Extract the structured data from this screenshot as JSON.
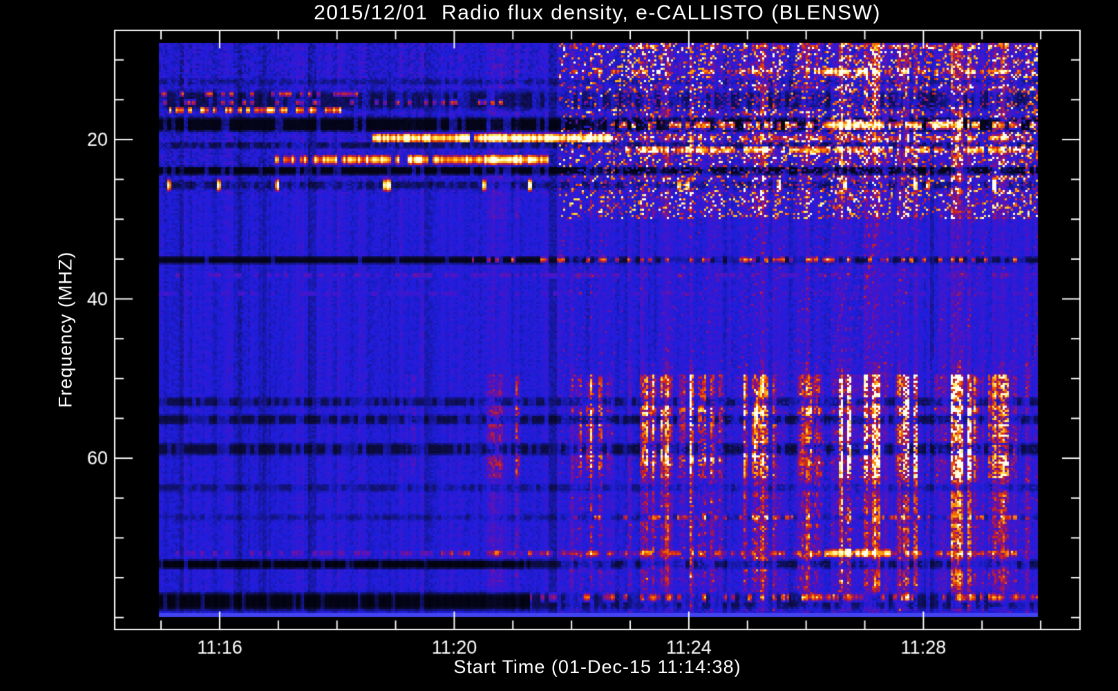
{
  "window": {
    "background": "#000000",
    "frame_color": "#ffffff",
    "text_color": "#ffffff"
  },
  "chart_data": {
    "type": "heatmap",
    "title": "2015/12/01  Radio flux density, e-CALLISTO (BLENSW)",
    "xlabel": "Start Time (01-Dec-15 11:14:38)",
    "ylabel": "Frequency (MHZ)",
    "legend": "none",
    "grid": false,
    "x_axis": {
      "unit": "time (HH:MM)",
      "major_ticks": [
        {
          "label": "11:16",
          "min": 16
        },
        {
          "label": "11:20",
          "min": 20
        },
        {
          "label": "11:24",
          "min": 24
        },
        {
          "label": "11:28",
          "min": 28
        }
      ],
      "minor_step_min": 1,
      "frame_range_min": [
        14.21,
        30.67
      ],
      "data_range_min": [
        14.96,
        29.95
      ]
    },
    "y_axis": {
      "unit": "MHz",
      "major_ticks": [
        20,
        40,
        60
      ],
      "minor_step": 5,
      "minor_range": [
        10,
        80
      ],
      "frame_range_mhz": [
        6.3,
        81.5
      ],
      "data_range_mhz": [
        7.9,
        79.9
      ],
      "direction": "increases_downward"
    },
    "colormap": [
      [
        0.0,
        "#000004"
      ],
      [
        0.18,
        "#0b0b38"
      ],
      [
        0.45,
        "#1e1ede"
      ],
      [
        0.58,
        "#4a14c8"
      ],
      [
        0.68,
        "#8c1278"
      ],
      [
        0.76,
        "#d42814"
      ],
      [
        0.86,
        "#ff8200"
      ],
      [
        0.94,
        "#ffe646"
      ],
      [
        1.0,
        "#fffff0"
      ]
    ],
    "background": {
      "base_level": 0.46,
      "noise_low_freq_amp": 0.17,
      "noise_high_freq_amp": 0.1,
      "noise_low_freq_below_mhz": 27,
      "red_tinge_after_min": 21.8
    },
    "bands": [
      {
        "f": [
          12.3,
          13.3
        ],
        "mode": "mult",
        "value": 0.7,
        "dash": 0.35
      },
      {
        "f": [
          13.6,
          16.6
        ],
        "mode": "mult",
        "value": 0.5,
        "dash": 0.45
      },
      {
        "f": [
          17.0,
          19.25
        ],
        "mode": "mult",
        "value": 0.16,
        "dash": 0.18
      },
      {
        "f": [
          20.3,
          21.2
        ],
        "mode": "mult",
        "value": 0.5,
        "dash": 0.45
      },
      {
        "f": [
          23.3,
          24.6
        ],
        "mode": "mult",
        "value": 0.14,
        "dash": 0.25
      },
      {
        "f": [
          25.1,
          26.4
        ],
        "mode": "mult",
        "value": 0.55,
        "dash": 0.5
      },
      {
        "f": [
          34.6,
          35.7
        ],
        "t": [
          14.9,
          21.5
        ],
        "mode": "mult",
        "value": 0.18,
        "dash": 0.1
      },
      {
        "f": [
          34.6,
          35.7
        ],
        "t": [
          21.5,
          30.0
        ],
        "mode": "mult",
        "value": 0.4,
        "dash": 0.55
      },
      {
        "f": [
          36.6,
          37.6
        ],
        "mode": "tinge",
        "value": 0.58,
        "dash": 0.55
      },
      {
        "f": [
          38.8,
          39.7
        ],
        "mode": "tinge",
        "value": 0.55,
        "dash": 0.6
      },
      {
        "f": [
          52.2,
          53.6
        ],
        "mode": "mult",
        "value": 0.5,
        "dash": 0.45
      },
      {
        "f": [
          54.4,
          55.9
        ],
        "mode": "mult",
        "value": 0.45,
        "dash": 0.4
      },
      {
        "f": [
          57.9,
          59.8
        ],
        "mode": "mult",
        "value": 0.42,
        "dash": 0.4
      },
      {
        "f": [
          63.1,
          64.3
        ],
        "mode": "mult",
        "value": 0.65,
        "dash": 0.5
      },
      {
        "f": [
          66.9,
          67.9
        ],
        "mode": "mult",
        "value": 0.7,
        "dash": 0.5
      },
      {
        "f": [
          71.3,
          72.5
        ],
        "mode": "tinge",
        "value": 0.6,
        "dash": 0.5
      },
      {
        "f": [
          72.6,
          74.0
        ],
        "t": [
          14.9,
          21.3
        ],
        "mode": "mult",
        "value": 0.13,
        "dash": 0.12,
        "comb": true
      },
      {
        "f": [
          72.6,
          74.0
        ],
        "t": [
          21.3,
          30.0
        ],
        "mode": "mult",
        "value": 0.45,
        "dash": 0.5
      },
      {
        "f": [
          76.6,
          79.3
        ],
        "t": [
          14.9,
          21.3
        ],
        "mode": "mult",
        "value": 0.15,
        "dash": 0.08,
        "comb": true
      },
      {
        "f": [
          76.6,
          79.3
        ],
        "t": [
          21.3,
          30.0
        ],
        "mode": "mult",
        "value": 0.5,
        "dash": 0.5
      },
      {
        "f": [
          79.3,
          80.0
        ],
        "mode": "color",
        "color": "#4343f0"
      }
    ],
    "lines": [
      {
        "f": 16.35,
        "h": 0.5,
        "t": [
          15.15,
          18.5
        ],
        "v": 0.88,
        "dash": 0.5
      },
      {
        "f": 14.3,
        "h": 0.4,
        "t": [
          15.0,
          18.6
        ],
        "v": 0.74,
        "dash": 0.62
      },
      {
        "f": 15.4,
        "h": 0.4,
        "t": [
          15.0,
          21.0
        ],
        "v": 0.72,
        "dash": 0.68
      },
      {
        "f": 19.85,
        "h": 0.65,
        "t": [
          18.6,
          22.65
        ],
        "v": 1.02,
        "dash": 0.04
      },
      {
        "f": 19.85,
        "h": 0.45,
        "t": [
          22.65,
          29.95
        ],
        "v": 0.74,
        "dash": 0.5
      },
      {
        "f": 22.55,
        "h": 0.7,
        "t": [
          16.95,
          18.5
        ],
        "v": 0.88,
        "dash": 0.22
      },
      {
        "f": 22.55,
        "h": 0.7,
        "t": [
          18.5,
          21.6
        ],
        "v": 0.97,
        "dash": 0.05
      },
      {
        "f": 21.35,
        "h": 0.55,
        "t": [
          22.9,
          29.95
        ],
        "v": 0.84,
        "dash": 0.28
      },
      {
        "f": 18.2,
        "h": 0.5,
        "t": [
          22.8,
          29.95
        ],
        "v": 0.78,
        "dash": 0.42
      },
      {
        "f": 18.2,
        "h": 0.6,
        "t": [
          26.35,
          27.35
        ],
        "v": 0.98,
        "dash": 0.05
      },
      {
        "f": 18.2,
        "h": 0.6,
        "t": [
          28.15,
          28.8
        ],
        "v": 0.92,
        "dash": 0.08
      },
      {
        "f": 11.5,
        "h": 0.45,
        "t": [
          21.9,
          29.95
        ],
        "v": 0.78,
        "dash": 0.5
      },
      {
        "f": 11.5,
        "h": 0.55,
        "t": [
          26.3,
          27.15
        ],
        "v": 0.96,
        "dash": 0.08
      },
      {
        "f": 8.4,
        "h": 0.4,
        "t": [
          21.9,
          29.95
        ],
        "v": 0.72,
        "dash": 0.55
      },
      {
        "f": 25.75,
        "h": 0.9,
        "t": [
          15.0,
          29.95
        ],
        "v": 0.95,
        "dash": 0.94
      },
      {
        "f": 35.1,
        "h": 0.4,
        "t": [
          20.3,
          29.95
        ],
        "v": 0.76,
        "dash": 0.6
      },
      {
        "f": 67.4,
        "h": 0.45,
        "t": [
          21.9,
          29.95
        ],
        "v": 0.72,
        "dash": 0.55
      },
      {
        "f": 71.9,
        "h": 0.5,
        "t": [
          19.4,
          29.95
        ],
        "v": 0.74,
        "dash": 0.55
      },
      {
        "f": 71.9,
        "h": 0.6,
        "t": [
          26.3,
          27.45
        ],
        "v": 0.9,
        "dash": 0.12
      },
      {
        "f": 77.4,
        "h": 0.6,
        "t": [
          21.3,
          29.95
        ],
        "v": 0.72,
        "dash": 0.5
      }
    ],
    "burst_zones": [
      {
        "f": [
          49.5,
          62.6
        ],
        "w": 1.0
      },
      {
        "f": [
          62.6,
          76.0
        ],
        "w": 0.55
      },
      {
        "f": [
          76.0,
          79.2
        ],
        "w": 0.35
      },
      {
        "f": [
          30.0,
          49.5
        ],
        "w": 0.14
      },
      {
        "f": [
          7.9,
          30.0
        ],
        "w": 0.42
      }
    ],
    "burst_core_rows": [
      [
        53.4,
        56.0
      ],
      [
        58.2,
        60.8
      ]
    ],
    "bursts": [
      {
        "t": [
          19.15,
          19.4
        ],
        "amp": 0.3
      },
      {
        "t": [
          20.5,
          20.92
        ],
        "amp": 0.3
      },
      {
        "t": [
          20.95,
          21.15
        ],
        "amp": 0.5
      },
      {
        "t": [
          22.0,
          22.7
        ],
        "amp": 0.55
      },
      {
        "t": [
          23.15,
          23.75
        ],
        "amp": 0.7
      },
      {
        "t": [
          23.8,
          24.62
        ],
        "amp": 0.75
      },
      {
        "t": [
          24.7,
          25.5
        ],
        "amp": 0.7
      },
      {
        "t": [
          25.8,
          26.32
        ],
        "amp": 0.55
      },
      {
        "t": [
          26.35,
          27.42
        ],
        "amp": 1.1
      },
      {
        "t": [
          27.5,
          28.0
        ],
        "amp": 0.8
      },
      {
        "t": [
          28.18,
          28.95
        ],
        "amp": 0.95
      },
      {
        "t": [
          29.0,
          29.6
        ],
        "amp": 0.6
      }
    ],
    "speckle": {
      "t_after": 21.8,
      "low_f_max": 30,
      "low_prob": 0.22,
      "low_add": [
        0.18,
        0.5
      ],
      "high_prob": 0.05,
      "high_add": 0.13
    }
  }
}
